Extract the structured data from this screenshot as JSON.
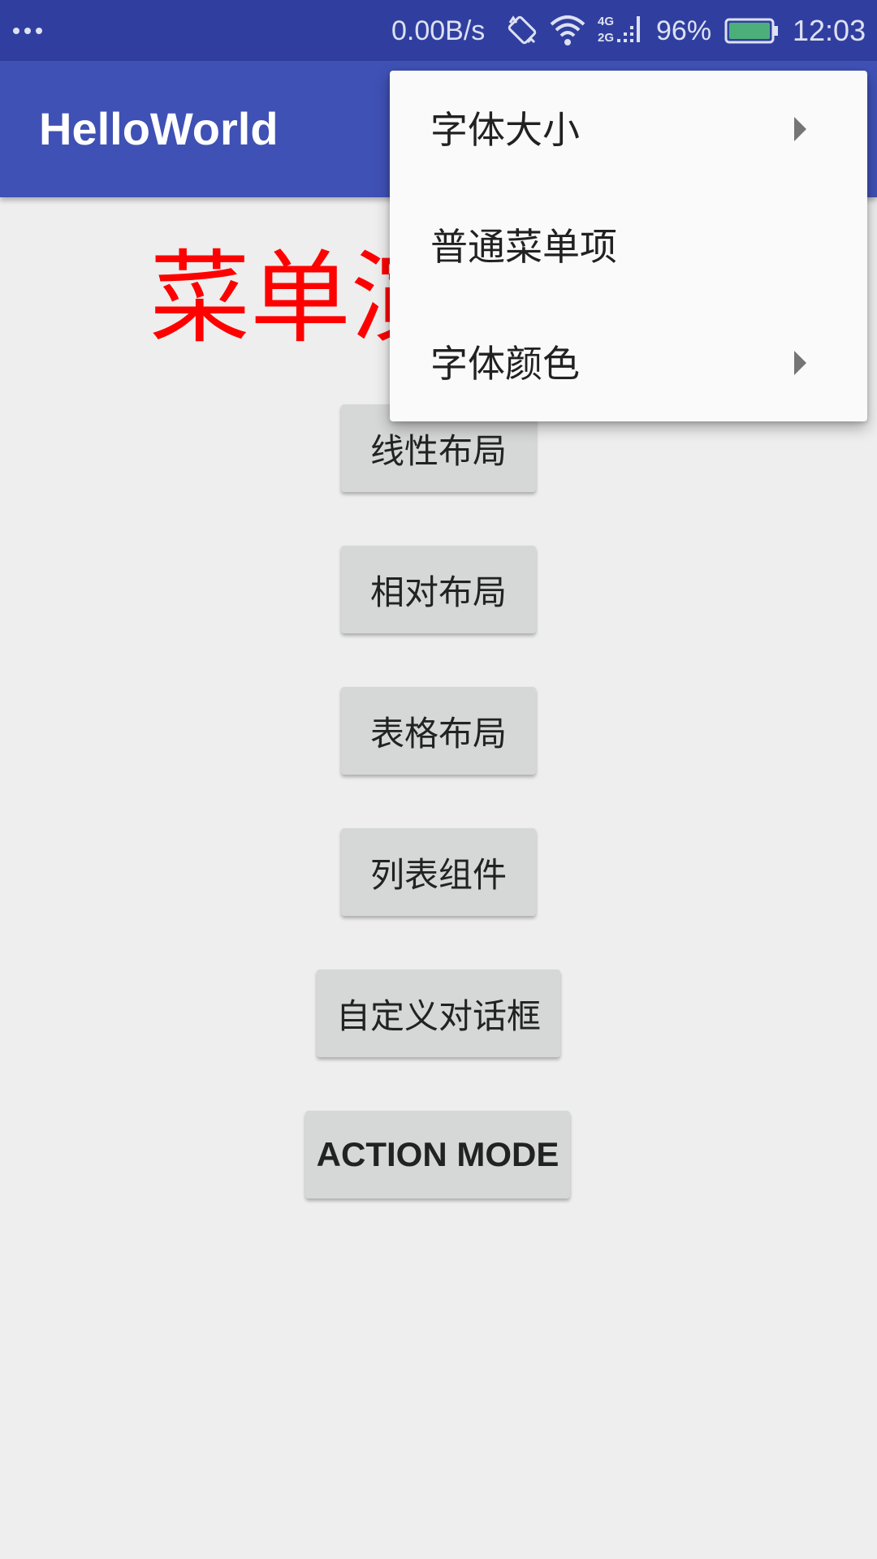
{
  "status_bar": {
    "net_speed": "0.00B/s",
    "battery_percent": "96%",
    "time": "12:03",
    "icons": [
      "more-dots-icon",
      "rotation-lock-icon",
      "wifi-icon",
      "cellular-signal-icon",
      "battery-icon"
    ],
    "signal_labels": [
      "4G",
      "2G"
    ],
    "background_color": "#303F9F"
  },
  "app_bar": {
    "title": "HelloWorld",
    "background_color": "#3F51B5"
  },
  "main": {
    "headline": "菜单演示",
    "headline_color": "#FF0000",
    "buttons": [
      {
        "label": "线性布局"
      },
      {
        "label": "相对布局"
      },
      {
        "label": "表格布局"
      },
      {
        "label": "列表组件"
      },
      {
        "label": "自定义对话框"
      },
      {
        "label": "ACTION MODE"
      }
    ]
  },
  "options_menu": {
    "items": [
      {
        "label": "字体大小",
        "has_submenu": true
      },
      {
        "label": "普通菜单项",
        "has_submenu": false
      },
      {
        "label": "字体颜色",
        "has_submenu": true
      }
    ]
  }
}
